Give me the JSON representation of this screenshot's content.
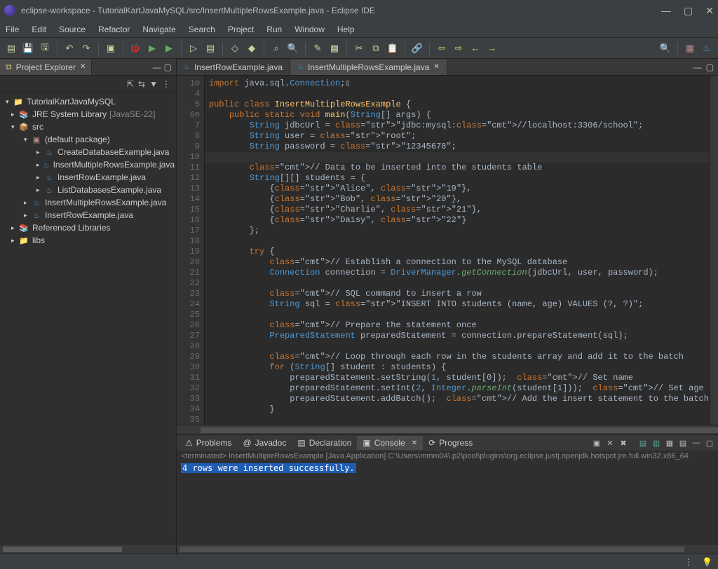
{
  "window": {
    "title": "eclipse-workspace - TutorialKartJavaMySQL/src/InsertMultipleRowsExample.java - Eclipse IDE"
  },
  "menu": {
    "items": [
      "File",
      "Edit",
      "Source",
      "Refactor",
      "Navigate",
      "Search",
      "Project",
      "Run",
      "Window",
      "Help"
    ]
  },
  "sidebar": {
    "title": "Project Explorer",
    "project": "TutorialKartJavaMySQL",
    "jre_label": "JRE System Library",
    "jre_suffix": "[JavaSE-22]",
    "src_label": "src",
    "pkg_label": "(default package)",
    "files_pkg": [
      "CreateDatabaseExample.java",
      "InsertMultipleRowsExample.java",
      "InsertRowExample.java",
      "ListDatabasesExample.java"
    ],
    "files_src": [
      "InsertMultipleRowsExample.java",
      "InsertRowExample.java"
    ],
    "ref_label": "Referenced Libraries",
    "libs_label": "libs"
  },
  "editor": {
    "tabs": [
      {
        "label": "InsertRowExample.java"
      },
      {
        "label": "InsertMultipleRowsExample.java"
      }
    ],
    "first_line_no": 1,
    "code_lines": [
      {
        "n": 1,
        "gut": " 1⊖",
        "raw": "import java.sql.Connection;▯"
      },
      {
        "n": 4,
        "gut": "  4",
        "raw": ""
      },
      {
        "n": 5,
        "gut": "  5",
        "raw": "public class InsertMultipleRowsExample {"
      },
      {
        "n": 6,
        "gut": " 6⊖",
        "raw": "    public static void main(String[] args) {"
      },
      {
        "n": 7,
        "gut": "  7",
        "raw": "        String jdbcUrl = \"jdbc:mysql://localhost:3306/school\";"
      },
      {
        "n": 8,
        "gut": "  8",
        "raw": "        String user = \"root\";"
      },
      {
        "n": 9,
        "gut": "  9",
        "raw": "        String password = \"12345678\";"
      },
      {
        "n": 10,
        "gut": " 10",
        "raw": ""
      },
      {
        "n": 11,
        "gut": " 11",
        "raw": "        // Data to be inserted into the students table"
      },
      {
        "n": 12,
        "gut": " 12",
        "raw": "        String[][] students = {"
      },
      {
        "n": 13,
        "gut": " 13",
        "raw": "            {\"Alice\", \"19\"},"
      },
      {
        "n": 14,
        "gut": " 14",
        "raw": "            {\"Bob\", \"20\"},"
      },
      {
        "n": 15,
        "gut": " 15",
        "raw": "            {\"Charlie\", \"21\"},"
      },
      {
        "n": 16,
        "gut": " 16",
        "raw": "            {\"Daisy\", \"22\"}"
      },
      {
        "n": 17,
        "gut": " 17",
        "raw": "        };"
      },
      {
        "n": 18,
        "gut": " 18",
        "raw": ""
      },
      {
        "n": 19,
        "gut": " 19",
        "raw": "        try {"
      },
      {
        "n": 20,
        "gut": " 20",
        "raw": "            // Establish a connection to the MySQL database"
      },
      {
        "n": 21,
        "gut": " 21",
        "raw": "            Connection connection = DriverManager.getConnection(jdbcUrl, user, password);"
      },
      {
        "n": 22,
        "gut": " 22",
        "raw": ""
      },
      {
        "n": 23,
        "gut": " 23",
        "raw": "            // SQL command to insert a row"
      },
      {
        "n": 24,
        "gut": " 24",
        "raw": "            String sql = \"INSERT INTO students (name, age) VALUES (?, ?)\";"
      },
      {
        "n": 25,
        "gut": " 25",
        "raw": ""
      },
      {
        "n": 26,
        "gut": " 26",
        "raw": "            // Prepare the statement once"
      },
      {
        "n": 27,
        "gut": " 27",
        "raw": "            PreparedStatement preparedStatement = connection.prepareStatement(sql);"
      },
      {
        "n": 28,
        "gut": " 28",
        "raw": ""
      },
      {
        "n": 29,
        "gut": " 29",
        "raw": "            // Loop through each row in the students array and add it to the batch"
      },
      {
        "n": 30,
        "gut": " 30",
        "raw": "            for (String[] student : students) {"
      },
      {
        "n": 31,
        "gut": " 31",
        "raw": "                preparedStatement.setString(1, student[0]);  // Set name"
      },
      {
        "n": 32,
        "gut": " 32",
        "raw": "                preparedStatement.setInt(2, Integer.parseInt(student[1]));  // Set age"
      },
      {
        "n": 33,
        "gut": " 33",
        "raw": "                preparedStatement.addBatch();  // Add the insert statement to the batch"
      },
      {
        "n": 34,
        "gut": " 34",
        "raw": "            }"
      },
      {
        "n": 35,
        "gut": " 35",
        "raw": ""
      }
    ]
  },
  "bottom": {
    "tabs": [
      "Problems",
      "Javadoc",
      "Declaration",
      "Console",
      "Progress"
    ],
    "active_index": 3,
    "console_header": "<terminated> InsertMultipleRowsExample [Java Application] C:\\Users\\mmm04\\.p2\\pool\\plugins\\org.eclipse.justj.openjdk.hotspot.jre.full.win32.x86_64",
    "console_line": "4 rows were inserted successfully."
  }
}
